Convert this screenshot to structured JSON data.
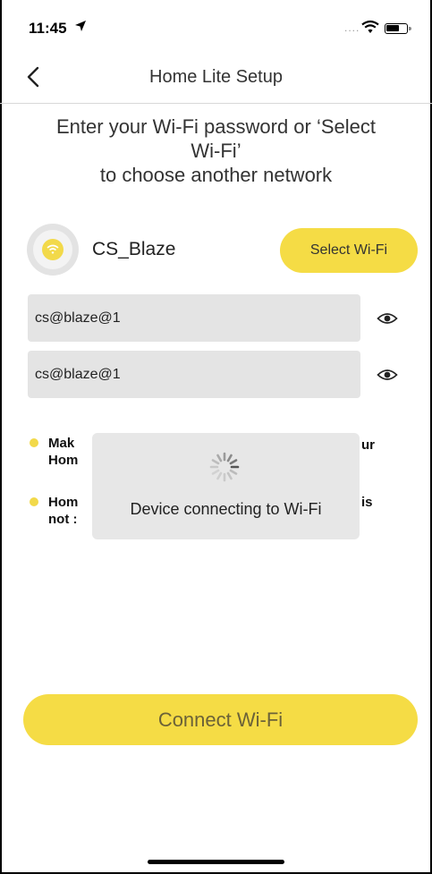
{
  "status_bar": {
    "time": "11:45",
    "location_icon": "location-arrow-icon",
    "signal": "....",
    "wifi_icon": "wifi-icon",
    "battery_icon": "battery-icon"
  },
  "nav": {
    "back_icon": "chevron-left-icon",
    "title": "Home Lite Setup"
  },
  "instruction": {
    "line1": "Enter your Wi-Fi password or ‘Select",
    "line2": "Wi-Fi’",
    "line3": "to choose another network"
  },
  "network": {
    "icon": "wifi-signal-icon",
    "name": "CS_Blaze",
    "select_label": "Select Wi-Fi"
  },
  "fields": {
    "password": "cs@blaze@1",
    "confirm_password": "cs@blaze@1",
    "toggle_icon": "eye-icon"
  },
  "notes": [
    {
      "line1": "Mak",
      "line2": "Hom",
      "tail": "ur"
    },
    {
      "line1": "Hom",
      "line2": "not :",
      "tail": "is"
    }
  ],
  "toast": {
    "icon": "spinner-icon",
    "message": "Device connecting to Wi-Fi"
  },
  "connect_label": "Connect Wi-Fi",
  "colors": {
    "accent": "#f5dc45",
    "field_bg": "#e4e4e4",
    "toast_bg": "#e7e7e7"
  }
}
